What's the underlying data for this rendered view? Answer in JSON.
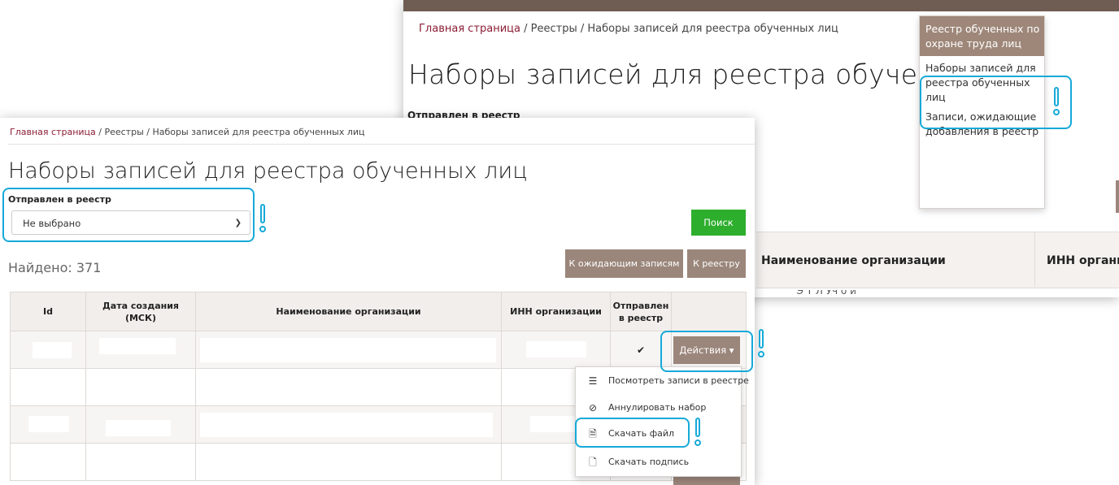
{
  "colors": {
    "accent_brown": "#9b867b",
    "header_brown": "#6f5c52",
    "green": "#2dae2d",
    "highlight_cyan": "#16a9d8",
    "link_red": "#8b1d34"
  },
  "breadcrumb": {
    "home": "Главная страница",
    "rest": " / Реестры / Наборы записей для реестра обученных лиц"
  },
  "back_panel": {
    "title": "Наборы записей для реестра обученны",
    "filter_label": "Отправлен в реестр",
    "menu": [
      "Реестр обученных по охране труда лиц",
      "Наборы записей для реестра обученных лиц",
      "Записи, ожидающие добавления в реестр"
    ],
    "table_headers": [
      "Наименование организации",
      "ИНН органи"
    ],
    "cut_row_text": "\"Э  Т  Л  Уч б й"
  },
  "front_panel": {
    "title": "Наборы записей для реестра обученных лиц",
    "filter_label": "Отправлен в реестр",
    "select_value": "Не выбрано",
    "search_button": "Поиск",
    "to_pending_button": "К ожидающим записям",
    "to_registry_button": "К реестру",
    "found": "Найдено: 371",
    "table_headers": [
      "Id",
      "Дата создания (МСК)",
      "Наименование организации",
      "ИНН организации",
      "Отправлен в реестр",
      ""
    ],
    "sent_mark": "✔",
    "actions_button": "Действия ▾",
    "actions_menu": [
      {
        "icon": "list-icon",
        "label": "Посмотреть записи в реестре"
      },
      {
        "icon": "cancel-icon",
        "label": "Аннулировать набор"
      },
      {
        "icon": "file-text-icon",
        "label": "Скачать файл"
      },
      {
        "icon": "file-icon",
        "label": "Скачать подпись"
      }
    ]
  }
}
